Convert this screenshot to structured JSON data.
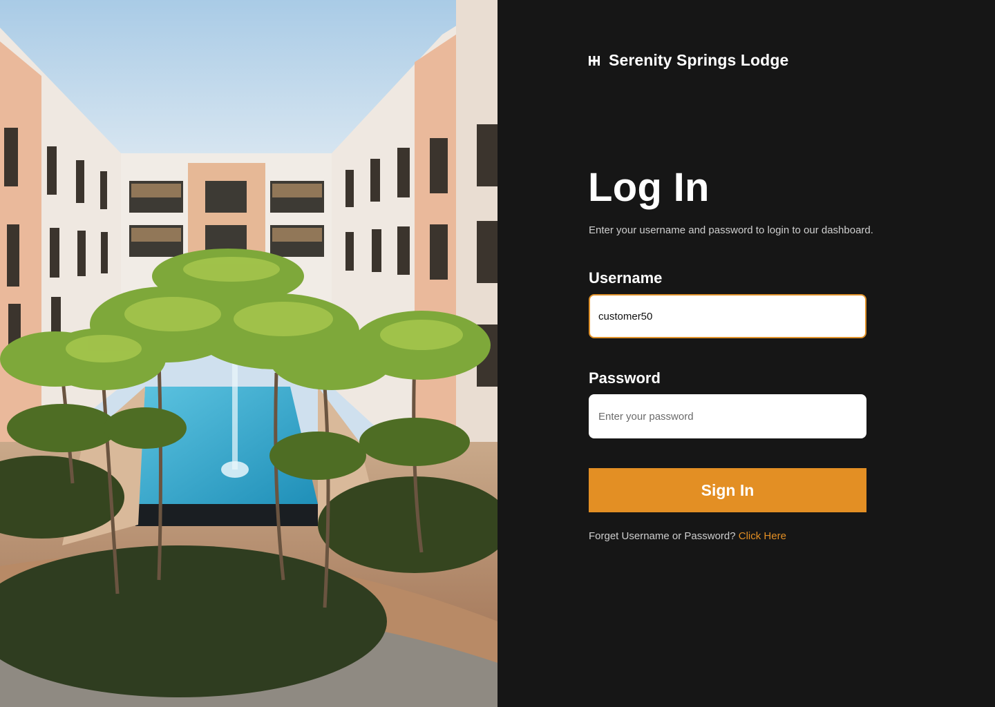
{
  "brand": {
    "name": "Serenity Springs Lodge",
    "icon": "hotel-logo-icon"
  },
  "login": {
    "title": "Log In",
    "subtitle": "Enter your username and password to login to our dashboard."
  },
  "form": {
    "username_label": "Username",
    "username_value": "customer50",
    "password_label": "Password",
    "password_placeholder": "Enter your password",
    "submit_label": "Sign In"
  },
  "forgot": {
    "text": "Forget Username or Password?",
    "link_label": "Click Here"
  },
  "colors": {
    "panel_background": "#161616",
    "accent": "#e38f24",
    "text_primary": "#ffffff",
    "text_secondary": "#cfcfcf"
  }
}
